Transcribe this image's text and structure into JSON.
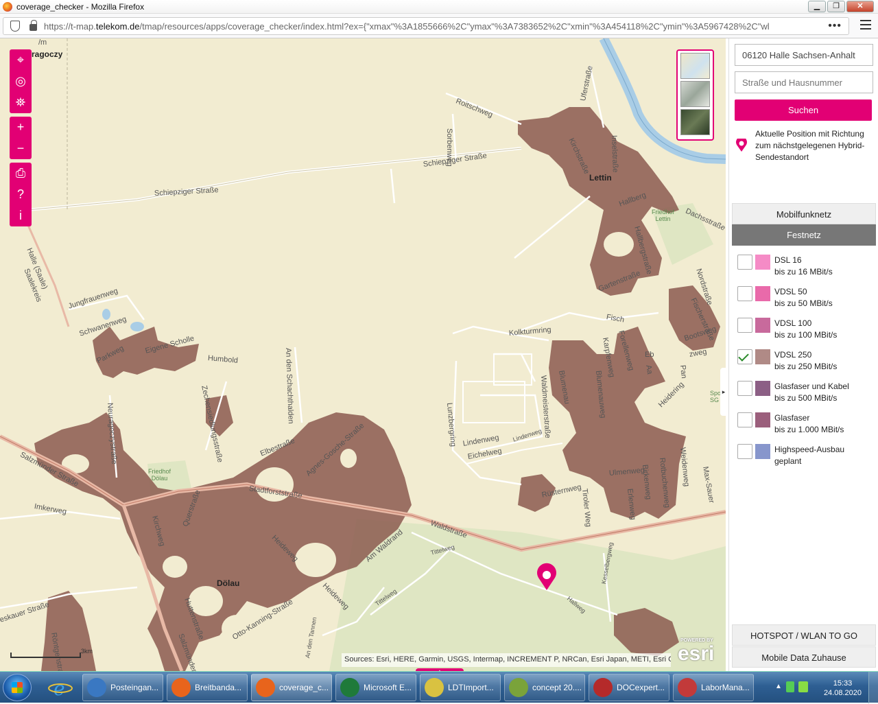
{
  "window": {
    "title": "coverage_checker - Mozilla Firefox",
    "controls": [
      "▁",
      "❐",
      "✕"
    ]
  },
  "browser": {
    "url_prefix": "https://t-map.",
    "url_domain": "telekom.de",
    "url_rest": "/tmap/resources/apps/coverage_checker/index.html?ex={\"xmax\"%3A1855666%2C\"ymax\"%3A7383652%2C\"xmin\"%3A454118%2C\"ymin\"%3A5967428%2C\"wl",
    "more": "•••"
  },
  "map": {
    "places": {
      "lettin": "Lettin",
      "doelau": "Dölau",
      "dragoczy": "ragoczy"
    },
    "streets": {
      "roitschweg": "Roitschweg",
      "sorbenweg": "Sorbenweg",
      "schiepziger1": "Schiepziger Straße",
      "schiepziger2": "Schiepziger Straße",
      "kirchstrasse": "Kirchstraße",
      "inselstrasse": "Inselstraße",
      "ufestrasse": "Uferstraße",
      "dachsstrasse": "Dachsstraße",
      "hallberg": "Hallberg",
      "hallbergstrasse": "Hallbergstraße",
      "gartenstrasse": "Gartenstraße",
      "nordstrasse": "Nordstraße",
      "fischerstrasse": "Fischerstraße",
      "bootsweg": "Bootsweg",
      "kolkturmring": "Kolkturmring",
      "fisch": "Fisch",
      "karpfenweg": "Karpfenweg",
      "forellenweg": "Forellenweg",
      "jungfrauenweg": "Jungfrauenweg",
      "schwanenweg": "Schwanenweg",
      "parkweg": "Parkweg",
      "eigenescholle": "Eigene Scholle",
      "humboldt": "Humbold",
      "anschachthalden": "An den Schachthalden",
      "zechensiedlung": "Zechensiedlungsstraße",
      "neuragoczy": "Neuragoczystraße",
      "salzmuender": "Salzmünder Straße",
      "imkerweg": "Imkerweg",
      "elbestrasse": "Elbestraße",
      "agnesgosche": "Agnes-Gosche-Straße",
      "stadtforst": "Stadtforststraße",
      "waldstrasse": "Waldstraße",
      "kirchweg": "Kirchweg",
      "querstrasse": "Querstraße",
      "heideweg": "Heideweg",
      "heideweg2": "Heideweg",
      "amwaldrand": "Am Waldrand",
      "tittelweg": "Tittelweg",
      "tittelweg2": "Tittelweg",
      "hallweg": "Hallweg",
      "kesselbergweg": "Kesselbergweg",
      "huttenstrasse": "Huttenstraße",
      "ottokanning": "Otto-Kanning-Straße",
      "salzmuender2": "Salzmünder",
      "roentgen": "Röntgenstraße",
      "eskauer": "eskauer Straße",
      "lunzberg": "Lunzberg",
      "lunzbergring": "Lunzbergring",
      "lindenweg": "Lindenweg",
      "lindenweg2": "Lindenweg",
      "eichelweg": "Eichelweg",
      "waldmeister": "Waldmeisterstraße",
      "blumenau": "Blumenau",
      "blumenauweg": "Blumenauweg",
      "ruesternweg": "Rüsternweg",
      "tirolerweg": "Tiroler Weg",
      "ulmenweg": "Ulmenweg",
      "erlenweg": "Erlenweg",
      "birkenweg": "Birkenweg",
      "rotbuchenweg": "Rotbuchenweg",
      "weidenweg": "Weidenweg",
      "maxsauer": "Max-Sauer",
      "heidering": "Heidering",
      "zweg": "zweg",
      "pan": "Pan",
      "halle": "Halle (Saale)",
      "saalekreis": "Saalekreis",
      "amtannen": "An den Tannen",
      "m": "/m",
      "aa": "Aa",
      "eb": "Eb"
    },
    "green": {
      "friedhoflettin": "Friedhof\nLettin",
      "friedhofdoelau": "Friedhof\nDölau",
      "sport": "Spor\nSG H"
    },
    "attribution": "Sources: Esri, HERE, Garmin, USGS, Intermap, INCREMENT P, NRCan, Esri Japan, METI, Esri C...",
    "esri": "esri",
    "esri_powered": "POWERED BY",
    "scale": "3km",
    "tools": [
      "⌖",
      "◎",
      "⛯",
      "+",
      "−",
      "⎙",
      "?",
      "i"
    ]
  },
  "panel": {
    "location_value": "06120 Halle Sachsen-Anhalt",
    "street_placeholder": "Straße und Hausnummer",
    "search_label": "Suchen",
    "position_info": "Aktuelle Position mit Richtung zum nächstgelegenen Hybrid-Sendestandort",
    "tab_mobile": "Mobilfunknetz",
    "tab_fixed": "Festnetz",
    "legend": [
      {
        "name": "DSL 16",
        "desc": "bis zu 16 MBit/s",
        "color": "#f58bc6",
        "checked": false
      },
      {
        "name": "VDSL 50",
        "desc": "bis zu 50 MBit/s",
        "color": "#e96aaa",
        "checked": false
      },
      {
        "name": "VDSL 100",
        "desc": "bis zu 100 MBit/s",
        "color": "#c86a9c",
        "checked": false
      },
      {
        "name": "VDSL 250",
        "desc": "bis zu 250 MBit/s",
        "color": "#b08a86",
        "checked": true
      },
      {
        "name": "Glasfaser und Kabel",
        "desc": "bis zu 500 MBit/s",
        "color": "#8c5f85",
        "checked": false
      },
      {
        "name": "Glasfaser",
        "desc": "bis zu 1.000 MBit/s",
        "color": "#9b5f7c",
        "checked": false
      },
      {
        "name": "Highspeed-Ausbau",
        "desc": "geplant",
        "color": "#8796cc",
        "checked": false
      }
    ],
    "hotspot": "HOTSPOT / WLAN TO GO",
    "mobiledata": "Mobile Data Zuhause"
  },
  "taskbar": {
    "items": [
      {
        "label": "Posteingan...",
        "color": "#3a78c2"
      },
      {
        "label": "Breitbanda...",
        "color": "#e8641c"
      },
      {
        "label": "coverage_c...",
        "color": "#e8641c"
      },
      {
        "label": "Microsoft E...",
        "color": "#1f7a3a"
      },
      {
        "label": "LDTImport...",
        "color": "#d9c241"
      },
      {
        "label": "concept 20....",
        "color": "#7aa33a"
      },
      {
        "label": "DOCexpert...",
        "color": "#b52a2a"
      },
      {
        "label": "LaborMana...",
        "color": "#c23a3a"
      }
    ],
    "time": "15:33",
    "date": "24.08.2020"
  },
  "colors": {
    "magenta": "#e20074",
    "coverage": "#8c5a50"
  }
}
